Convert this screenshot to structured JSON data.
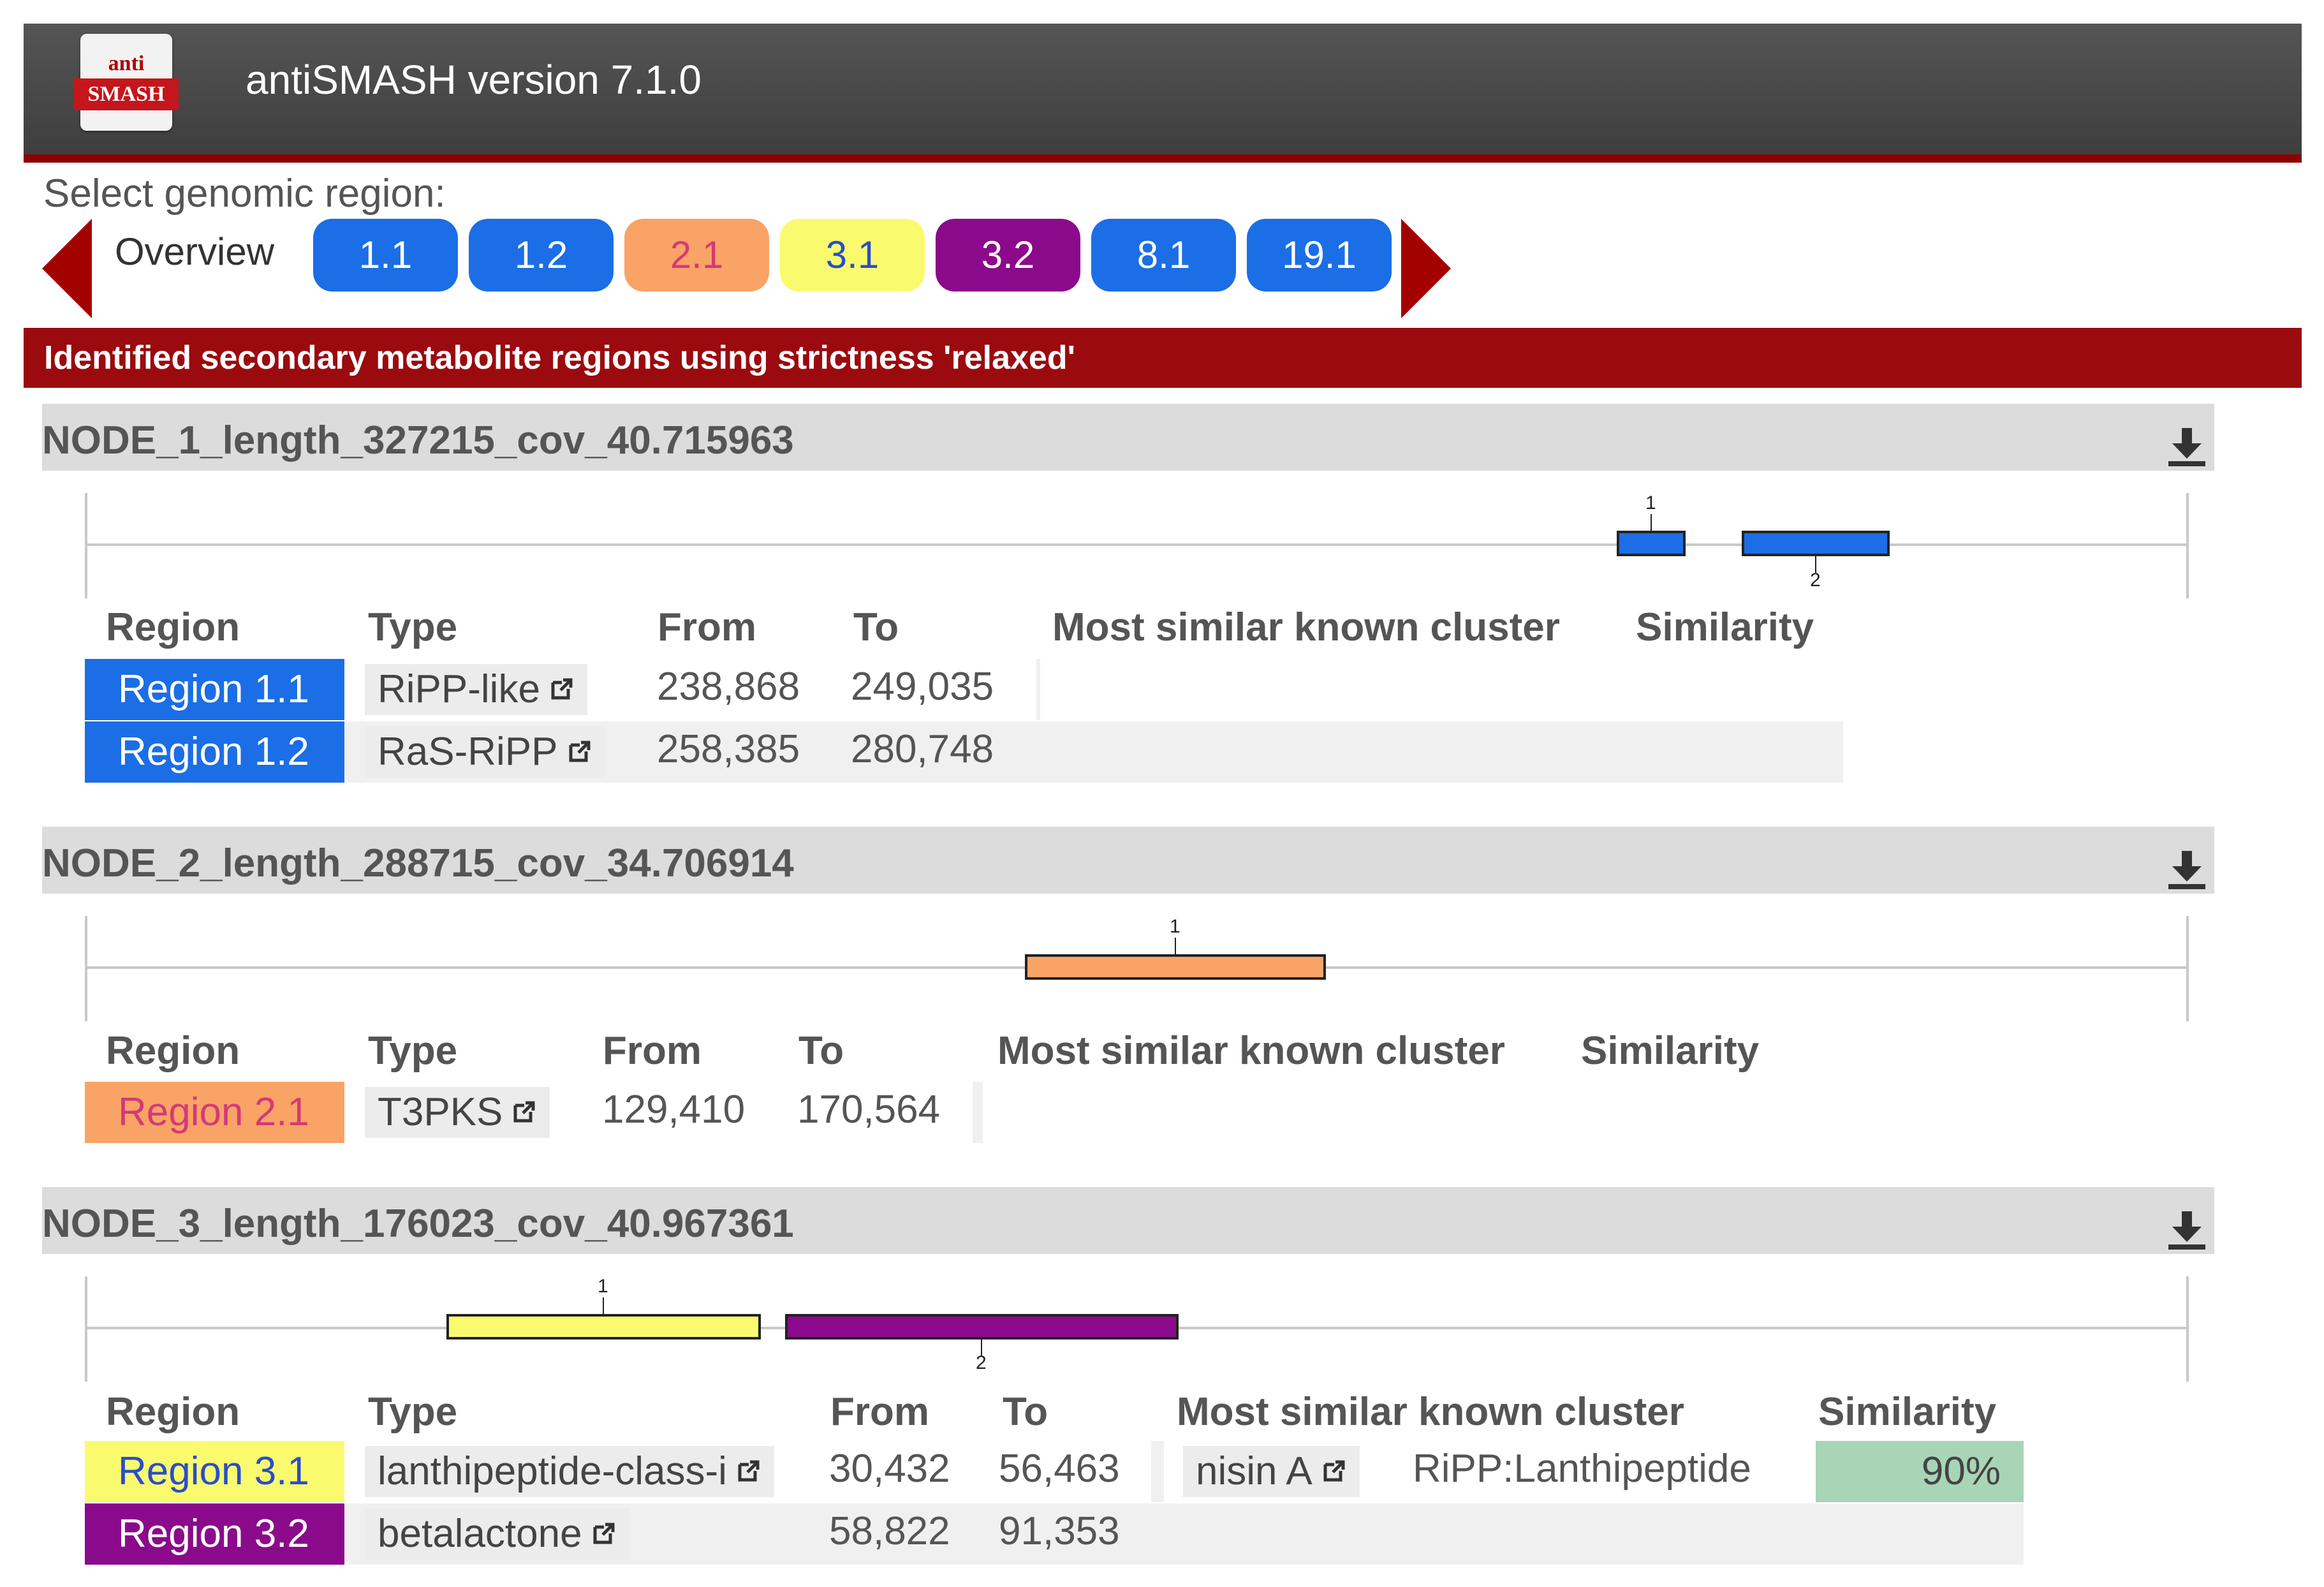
{
  "header": {
    "logo_top": "anti",
    "logo_bottom": "SMASH",
    "app_title": "antiSMASH version 7.1.0"
  },
  "selector": {
    "label": "Select genomic region:",
    "overview": "Overview",
    "regions": [
      {
        "label": "1.1",
        "bg": "#1b6ee6",
        "fg": "#ffffff"
      },
      {
        "label": "1.2",
        "bg": "#1b6ee6",
        "fg": "#ffffff"
      },
      {
        "label": "2.1",
        "bg": "#f9a366",
        "fg": "#d23a76"
      },
      {
        "label": "3.1",
        "bg": "#fafa6e",
        "fg": "#2a4dcc"
      },
      {
        "label": "3.2",
        "bg": "#8b0a8b",
        "fg": "#ffffff"
      },
      {
        "label": "8.1",
        "bg": "#1b6ee6",
        "fg": "#ffffff"
      },
      {
        "label": "19.1",
        "bg": "#1b6ee6",
        "fg": "#ffffff"
      }
    ]
  },
  "banner": "Identified secondary metabolite regions using strictness 'relaxed'",
  "table_headers": {
    "region": "Region",
    "type": "Type",
    "from": "From",
    "to": "To",
    "most_similar": "Most similar known cluster",
    "similarity": "Similarity"
  },
  "records": [
    {
      "name": "NODE_1_length_327215_cov_40.715963",
      "map_labels": [
        "1",
        "2"
      ],
      "rows": [
        {
          "region": "Region 1.1",
          "type": "RiPP-like",
          "from": "238,868",
          "to": "249,035",
          "cluster": "",
          "cluster_type": "",
          "similarity": ""
        },
        {
          "region": "Region 1.2",
          "type": "RaS-RiPP",
          "from": "258,385",
          "to": "280,748",
          "cluster": "",
          "cluster_type": "",
          "similarity": ""
        }
      ]
    },
    {
      "name": "NODE_2_length_288715_cov_34.706914",
      "map_labels": [
        "1"
      ],
      "rows": [
        {
          "region": "Region 2.1",
          "type": "T3PKS",
          "from": "129,410",
          "to": "170,564",
          "cluster": "",
          "cluster_type": "",
          "similarity": ""
        }
      ]
    },
    {
      "name": "NODE_3_length_176023_cov_40.967361",
      "map_labels": [
        "1",
        "2"
      ],
      "rows": [
        {
          "region": "Region 3.1",
          "type": "lanthipeptide-class-i",
          "from": "30,432",
          "to": "56,463",
          "cluster": "nisin A",
          "cluster_type": "RiPP:Lanthipeptide",
          "similarity": "90%"
        },
        {
          "region": "Region 3.2",
          "type": "betalactone",
          "from": "58,822",
          "to": "91,353",
          "cluster": "",
          "cluster_type": "",
          "similarity": ""
        }
      ]
    }
  ],
  "colors": {
    "header_bg": "#4a4a4a",
    "accent_red": "#9b0a0e",
    "ripp_blue": "#1b6ee6",
    "t3pks_orange": "#f9a366",
    "lanthi_yellow": "#fafa6e",
    "betalactone_purple": "#8b0a8b",
    "similarity_green": "#a8d5b5"
  },
  "icons": [
    "download-icon",
    "external-link-icon",
    "arrow-left-icon",
    "arrow-right-icon"
  ]
}
